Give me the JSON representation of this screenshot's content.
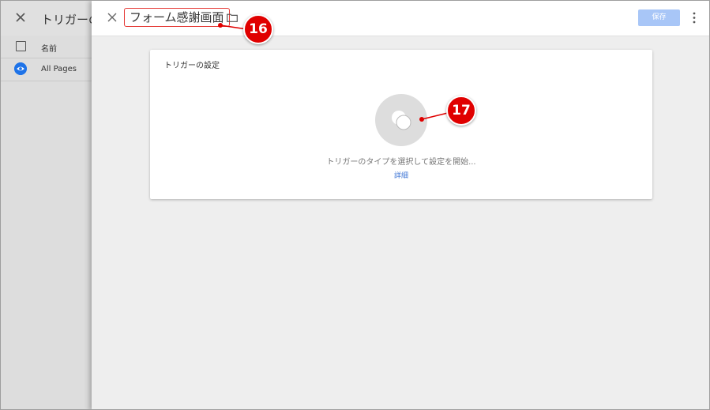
{
  "background_panel": {
    "title": "トリガーの",
    "column_name": "名前",
    "rows": [
      {
        "label": "All Pages"
      }
    ]
  },
  "editor": {
    "trigger_name": "フォーム感謝画面",
    "save_label": "保存",
    "card": {
      "title": "トリガーの設定",
      "prompt": "トリガーのタイプを選択して設定を開始...",
      "details_link": "詳細"
    }
  },
  "annotations": {
    "badge_16": "16",
    "badge_17": "17"
  },
  "colors": {
    "accent_blue": "#1e73e8",
    "save_button": "#a8c6f7",
    "annotation_red": "#e00000",
    "link_blue": "#3b73d4"
  }
}
